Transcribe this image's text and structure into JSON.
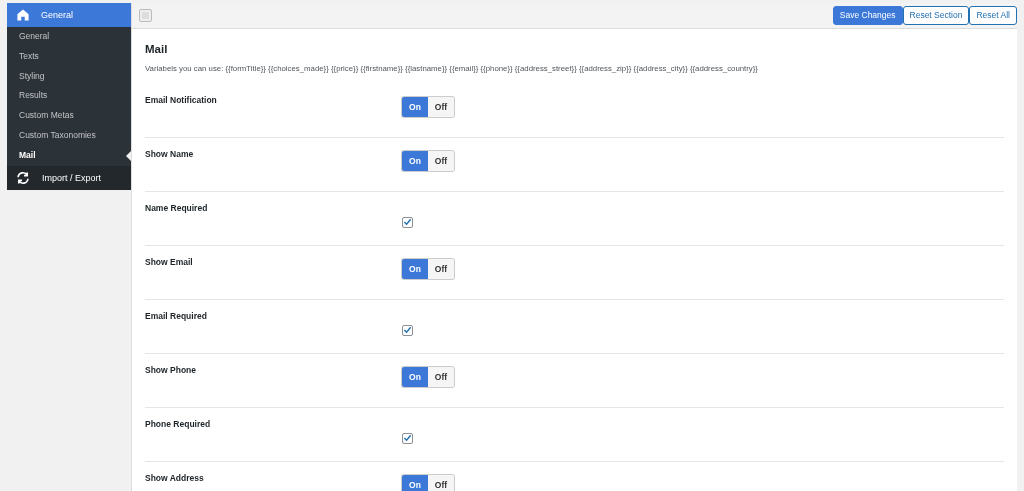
{
  "sidebar": {
    "header": {
      "label": "General"
    },
    "items": [
      {
        "label": "General",
        "selected": false
      },
      {
        "label": "Texts",
        "selected": false
      },
      {
        "label": "Styling",
        "selected": false
      },
      {
        "label": "Results",
        "selected": false
      },
      {
        "label": "Custom Metas",
        "selected": false
      },
      {
        "label": "Custom Taxonomies",
        "selected": false
      },
      {
        "label": "Mail",
        "selected": true
      }
    ],
    "footer": {
      "label": "Import / Export"
    }
  },
  "toolbar": {
    "buttons": [
      {
        "label": "Save Changes",
        "kind": "primary"
      },
      {
        "label": "Reset Section",
        "kind": "secondary"
      },
      {
        "label": "Reset All",
        "kind": "secondary"
      }
    ]
  },
  "section": {
    "title": "Mail",
    "description": "Variabels you can use: {{formTitle}} {{choices_made}} {{price}} {{firstname}} {{lastname}} {{email}} {{phone}} {{address_street}} {{address_zip}} {{address_city}} {{address_country}}"
  },
  "settings": [
    {
      "label": "Email Notification",
      "kind": "switch",
      "options": [
        {
          "label": "On",
          "selected": true
        },
        {
          "label": "Off",
          "selected": false
        }
      ]
    },
    {
      "label": "Show Name",
      "kind": "switch",
      "options": [
        {
          "label": "On",
          "selected": true
        },
        {
          "label": "Off",
          "selected": false
        }
      ]
    },
    {
      "label": "Name Required",
      "kind": "checkbox",
      "checked": true
    },
    {
      "label": "Show Email",
      "kind": "switch",
      "options": [
        {
          "label": "On",
          "selected": true
        },
        {
          "label": "Off",
          "selected": false
        }
      ]
    },
    {
      "label": "Email Required",
      "kind": "checkbox",
      "checked": true
    },
    {
      "label": "Show Phone",
      "kind": "switch",
      "options": [
        {
          "label": "On",
          "selected": true
        },
        {
          "label": "Off",
          "selected": false
        }
      ]
    },
    {
      "label": "Phone Required",
      "kind": "checkbox",
      "checked": true
    },
    {
      "label": "Show Address",
      "kind": "switch",
      "options": [
        {
          "label": "On",
          "selected": true
        },
        {
          "label": "Off",
          "selected": false
        }
      ]
    }
  ]
}
